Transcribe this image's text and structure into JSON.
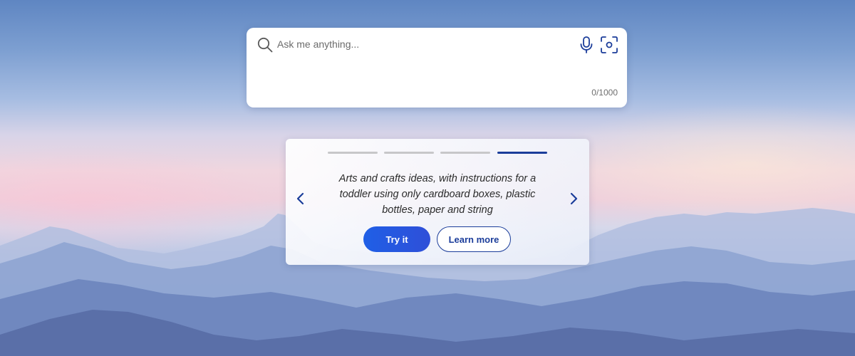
{
  "search": {
    "placeholder": "Ask me anything...",
    "char_count": "0/1000",
    "icons": [
      "search-icon",
      "microphone-icon",
      "camera-icon"
    ]
  },
  "suggestion_card": {
    "carousel_pages": 4,
    "active_page": 4,
    "text": "Arts and crafts ideas, with instructions for a toddler using only cardboard boxes, plastic bottles, paper and string",
    "try_label": "Try it",
    "learn_label": "Learn more",
    "icons": [
      "chevron-left-icon",
      "chevron-right-icon"
    ]
  },
  "colors": {
    "accent": "#1b3d9a",
    "button_primary": "#1f5fe6"
  }
}
